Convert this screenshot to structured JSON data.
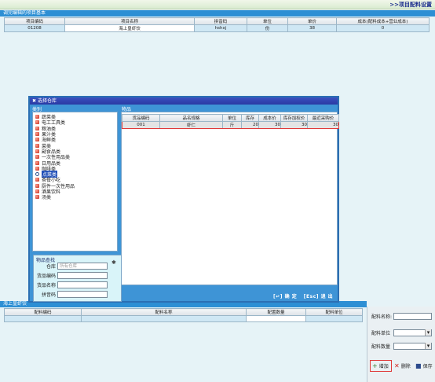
{
  "header": {
    "title": ">>项目配料设置"
  },
  "project_section": {
    "title": "调完编辑的项目基本",
    "columns": [
      "项目编码",
      "项目名称",
      "拼音码",
      "单位",
      "单价",
      "成本(配料成本+营业成本)"
    ],
    "row": [
      "01208",
      "海上皇虾饺",
      "hshxj",
      "份",
      "38",
      "0"
    ]
  },
  "dialog": {
    "title": "选择仓库",
    "category_tab": "类别",
    "goods_tab": "物品",
    "categories": [
      "蔬菜类",
      "电工工具类",
      "粮油类",
      "果汁类",
      "海鲜类",
      "菜类",
      "副食品类",
      "一次性用品类",
      "日用品类",
      "咖啡类",
      "点菜类",
      "茶餐小吃",
      "厨件一次性用品",
      "酒果饮料",
      "汤类"
    ],
    "selected_category": "点菜类",
    "goods_columns": [
      "货品编码",
      "品名规格",
      "单位",
      "库存",
      "成本价",
      "库存加权价",
      "最近采购价"
    ],
    "goods_row": [
      "001",
      "虾仁",
      "斤",
      "20",
      "30",
      "30",
      "30"
    ],
    "search": {
      "legend": "物品查找",
      "warehouse_label": "仓库",
      "warehouse_value": "所有仓库",
      "code_label": "货品编码",
      "name_label": "货品名称",
      "pinyin_label": "拼音码"
    },
    "actions": {
      "confirm": "[↵] 确 定",
      "exit": "[Esc] 退 出"
    }
  },
  "ingredients_section": {
    "title": "海上皇虾饺",
    "columns": [
      "配料编码",
      "配料名称",
      "配置数量",
      "配料单位"
    ]
  },
  "right_panel": {
    "name_label": "配料名称:",
    "unit_label": "配料单位",
    "qty_label": "配料数量",
    "add": "增加",
    "delete": "删除",
    "save": "保存"
  }
}
